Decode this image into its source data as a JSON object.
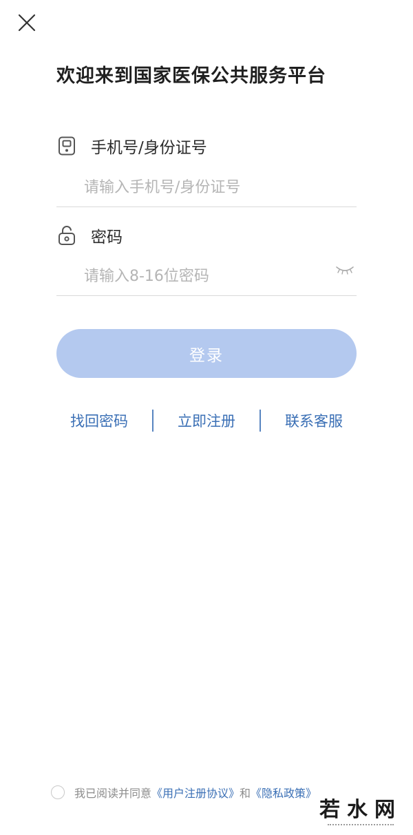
{
  "header": {
    "close_icon": "close-icon",
    "title": "欢迎来到国家医保公共服务平台"
  },
  "form": {
    "phone": {
      "icon": "phone-icon",
      "label": "手机号/身份证号",
      "value": "",
      "placeholder": "请输入手机号/身份证号"
    },
    "password": {
      "icon": "lock-icon",
      "label": "密码",
      "value": "",
      "placeholder": "请输入8-16位密码",
      "toggle_icon": "eye-closed-icon"
    },
    "login_label": "登录",
    "login_color": "#b4c9ef"
  },
  "links": {
    "forgot_password": "找回密码",
    "register": "立即注册",
    "contact_service": "联系客服",
    "link_color": "#3a6fb5"
  },
  "agreement": {
    "prefix": "我已阅读并同意",
    "user_agreement": "《用户注册协议》",
    "conjunction": "和",
    "privacy_policy": "《隐私政策》"
  },
  "watermark": {
    "text": "若水网"
  }
}
